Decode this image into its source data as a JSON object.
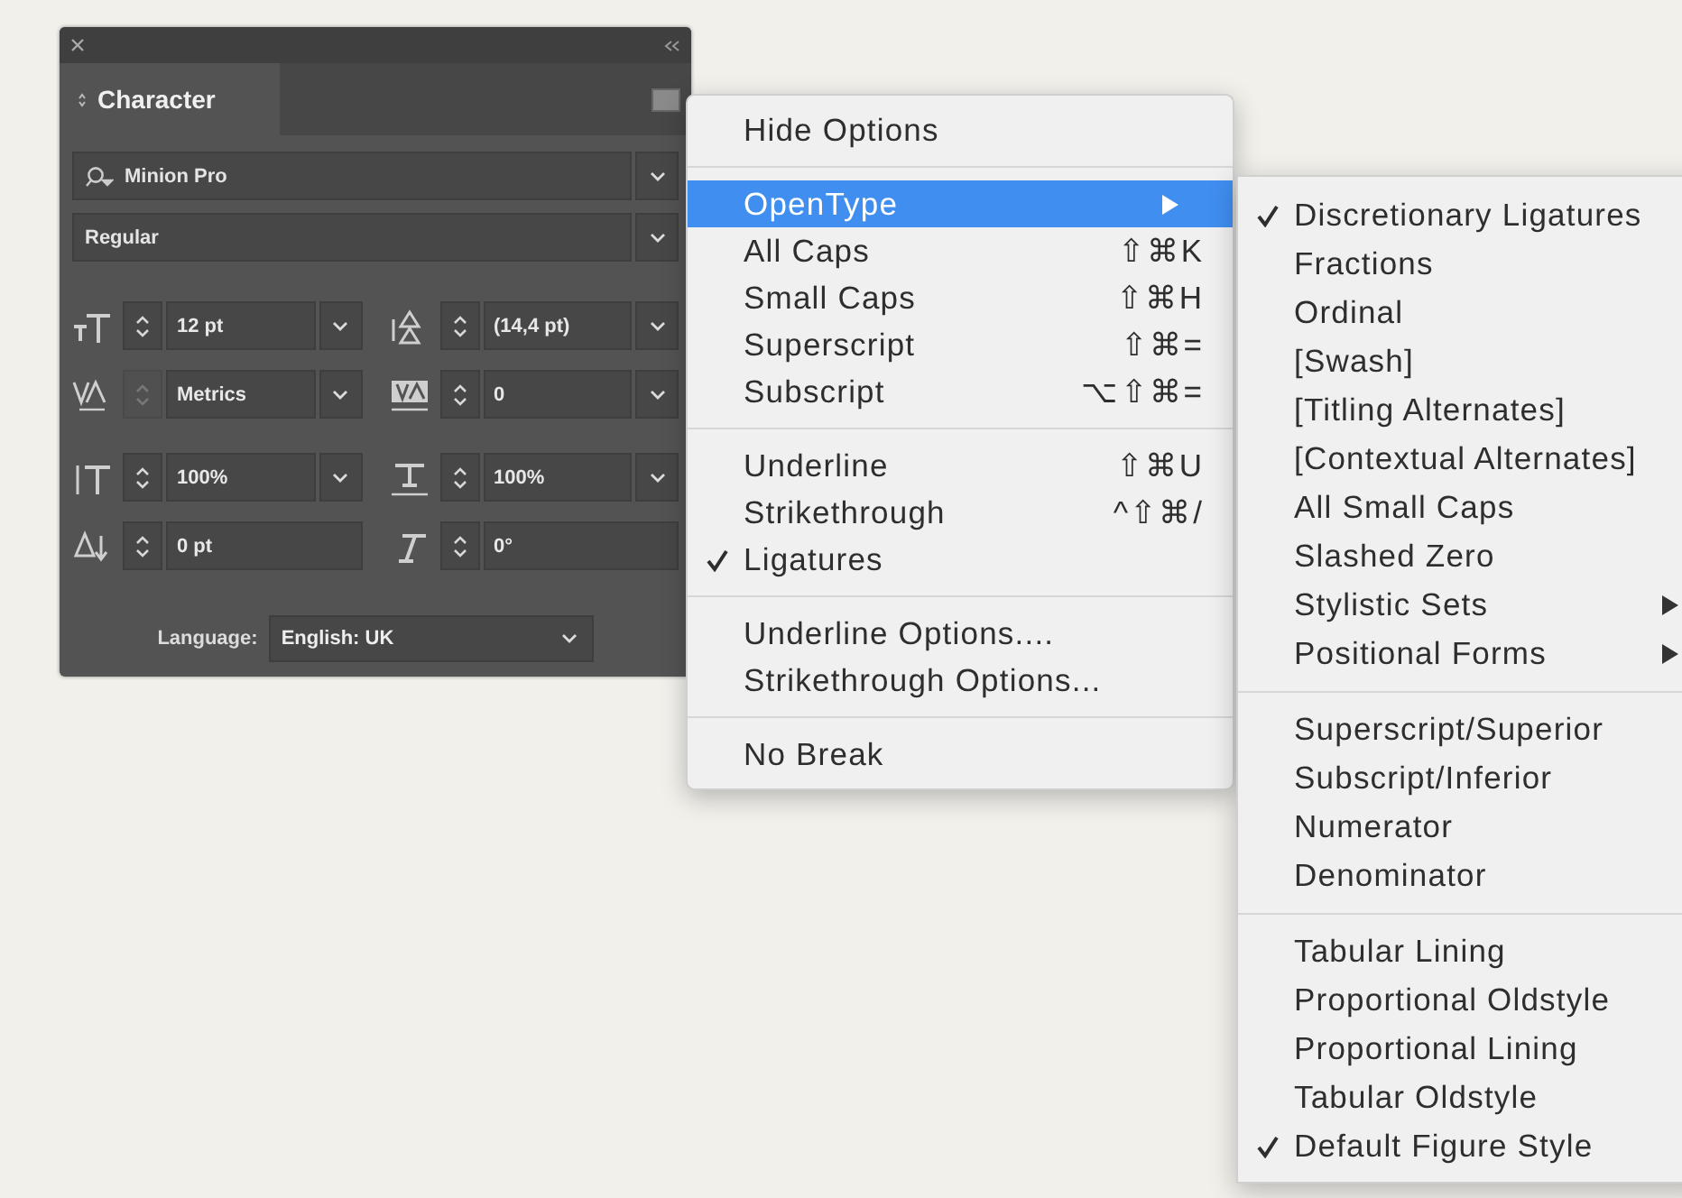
{
  "panel": {
    "tab": "Character",
    "font_family": "Minion Pro",
    "font_style": "Regular",
    "fields": [
      {
        "kind": "size",
        "value": "12 pt",
        "dropdown": true,
        "disabled": false
      },
      {
        "kind": "leading",
        "value": "(14,4 pt)",
        "dropdown": true,
        "disabled": false
      },
      {
        "kind": "kerning",
        "value": "Metrics",
        "dropdown": true,
        "disabled": true
      },
      {
        "kind": "tracking",
        "value": "0",
        "dropdown": true,
        "disabled": false
      },
      {
        "kind": "vscale",
        "value": "100%",
        "dropdown": true,
        "disabled": false
      },
      {
        "kind": "hscale",
        "value": "100%",
        "dropdown": true,
        "disabled": false
      },
      {
        "kind": "baseline",
        "value": "0 pt",
        "dropdown": false,
        "disabled": false
      },
      {
        "kind": "skew",
        "value": "0°",
        "dropdown": false,
        "disabled": false
      }
    ],
    "language": {
      "label": "Language:",
      "value": "English: UK"
    }
  },
  "menu": {
    "items": [
      {
        "kind": "item",
        "label": "Hide Options",
        "checked": false,
        "selected": false,
        "submenu": false
      },
      {
        "kind": "separator"
      },
      {
        "kind": "item",
        "label": "OpenType",
        "checked": false,
        "selected": true,
        "submenu": true
      },
      {
        "kind": "item",
        "label": "All Caps",
        "shortcut": "⇧⌘K",
        "checked": false,
        "selected": false,
        "submenu": false
      },
      {
        "kind": "item",
        "label": "Small Caps",
        "shortcut": "⇧⌘H",
        "checked": false,
        "selected": false,
        "submenu": false
      },
      {
        "kind": "item",
        "label": "Superscript",
        "shortcut": "⇧⌘=",
        "checked": false,
        "selected": false,
        "submenu": false
      },
      {
        "kind": "item",
        "label": "Subscript",
        "shortcut": "⌥⇧⌘=",
        "checked": false,
        "selected": false,
        "submenu": false
      },
      {
        "kind": "separator"
      },
      {
        "kind": "item",
        "label": "Underline",
        "shortcut": "⇧⌘U",
        "checked": false,
        "selected": false,
        "submenu": false
      },
      {
        "kind": "item",
        "label": "Strikethrough",
        "shortcut": "^⇧⌘/",
        "checked": false,
        "selected": false,
        "submenu": false
      },
      {
        "kind": "item",
        "label": "Ligatures",
        "checked": true,
        "selected": false,
        "submenu": false
      },
      {
        "kind": "separator"
      },
      {
        "kind": "item",
        "label": "Underline Options....",
        "checked": false,
        "selected": false,
        "submenu": false
      },
      {
        "kind": "item",
        "label": "Strikethrough Options...",
        "checked": false,
        "selected": false,
        "submenu": false
      },
      {
        "kind": "separator"
      },
      {
        "kind": "item",
        "label": "No Break",
        "checked": false,
        "selected": false,
        "submenu": false
      }
    ]
  },
  "submenu": {
    "items": [
      {
        "kind": "item",
        "label": "Discretionary Ligatures",
        "checked": true,
        "selected": false,
        "submenu": false
      },
      {
        "kind": "item",
        "label": "Fractions",
        "checked": false,
        "selected": false,
        "submenu": false
      },
      {
        "kind": "item",
        "label": "Ordinal",
        "checked": false,
        "selected": false,
        "submenu": false
      },
      {
        "kind": "item",
        "label": "[Swash]",
        "checked": false,
        "selected": false,
        "submenu": false
      },
      {
        "kind": "item",
        "label": "[Titling Alternates]",
        "checked": false,
        "selected": false,
        "submenu": false
      },
      {
        "kind": "item",
        "label": "[Contextual Alternates]",
        "checked": false,
        "selected": false,
        "submenu": false
      },
      {
        "kind": "item",
        "label": "All Small Caps",
        "checked": false,
        "selected": false,
        "submenu": false
      },
      {
        "kind": "item",
        "label": "Slashed Zero",
        "checked": false,
        "selected": false,
        "submenu": false
      },
      {
        "kind": "item",
        "label": "Stylistic Sets",
        "checked": false,
        "selected": false,
        "submenu": true
      },
      {
        "kind": "item",
        "label": "Positional Forms",
        "checked": false,
        "selected": false,
        "submenu": true
      },
      {
        "kind": "separator"
      },
      {
        "kind": "item",
        "label": "Superscript/Superior",
        "checked": false,
        "selected": false,
        "submenu": false
      },
      {
        "kind": "item",
        "label": "Subscript/Inferior",
        "checked": false,
        "selected": false,
        "submenu": false
      },
      {
        "kind": "item",
        "label": "Numerator",
        "checked": false,
        "selected": false,
        "submenu": false
      },
      {
        "kind": "item",
        "label": "Denominator",
        "checked": false,
        "selected": false,
        "submenu": false
      },
      {
        "kind": "separator"
      },
      {
        "kind": "item",
        "label": "Tabular Lining",
        "checked": false,
        "selected": false,
        "submenu": false
      },
      {
        "kind": "item",
        "label": "Proportional Oldstyle",
        "checked": false,
        "selected": false,
        "submenu": false
      },
      {
        "kind": "item",
        "label": "Proportional Lining",
        "checked": false,
        "selected": false,
        "submenu": false
      },
      {
        "kind": "item",
        "label": "Tabular Oldstyle",
        "checked": false,
        "selected": false,
        "submenu": false
      },
      {
        "kind": "item",
        "label": "Default Figure Style",
        "checked": true,
        "selected": false,
        "submenu": false
      }
    ]
  }
}
